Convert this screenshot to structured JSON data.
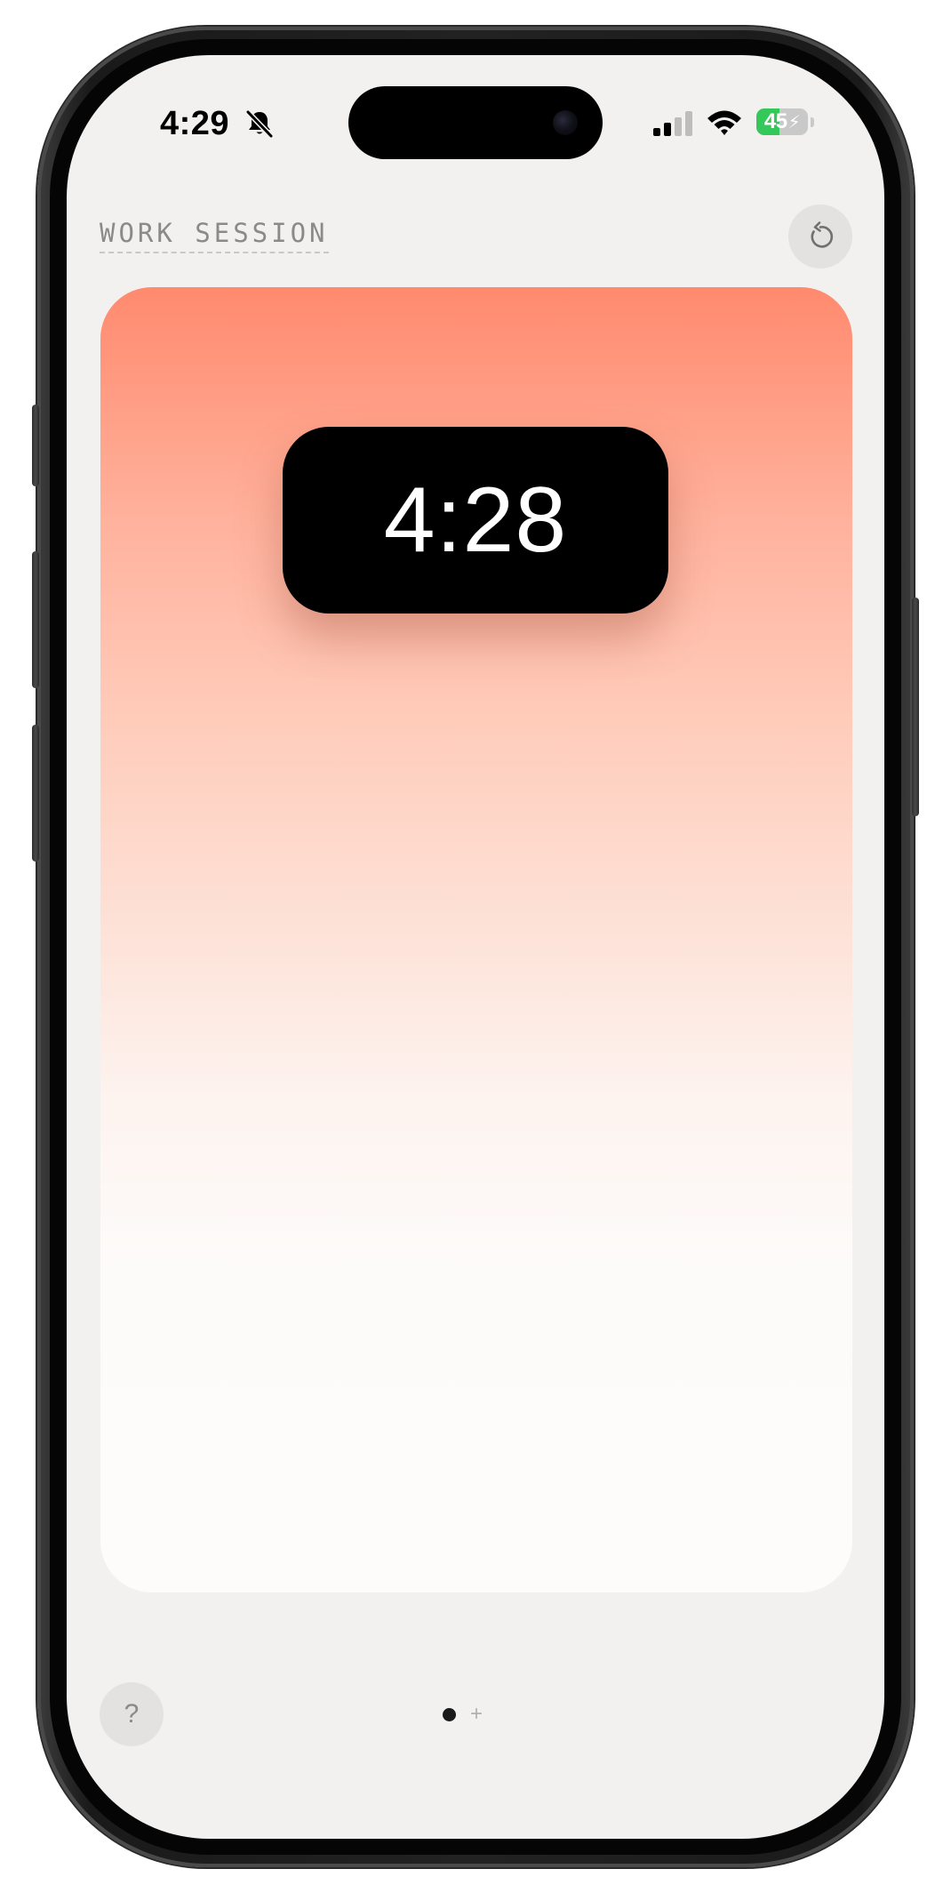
{
  "status_bar": {
    "time": "4:29",
    "battery_level": "45",
    "battery_fraction": 0.45,
    "battery_color": "#34c759",
    "icons": [
      "bell-slash-icon",
      "cellular-signal-icon",
      "wifi-icon",
      "battery-charging-icon"
    ]
  },
  "header": {
    "title": "WORK SESSION",
    "reset_icon": "reset-icon"
  },
  "timer": {
    "display": "4:28",
    "gradient_top_color": "#ff8a6e"
  },
  "footer": {
    "help_label": "?",
    "add_page_label": "+",
    "page_count": 1,
    "active_page": 1
  }
}
